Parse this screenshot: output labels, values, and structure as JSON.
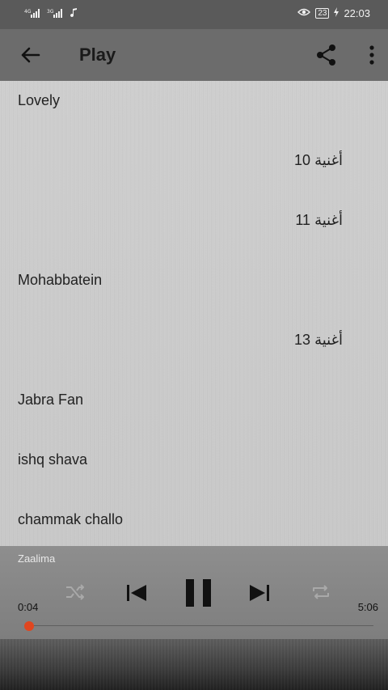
{
  "status_bar": {
    "signal1": "4G",
    "signal2": "3G",
    "battery": "23",
    "time": "22:03",
    "icons": [
      "signal-icon",
      "music-note-icon",
      "eye-icon",
      "battery-icon",
      "charging-icon"
    ]
  },
  "app_bar": {
    "title": "Play",
    "icons": [
      "back-arrow-icon",
      "share-icon",
      "more-vert-icon"
    ]
  },
  "playlist": {
    "items": [
      {
        "label": "Lovely"
      },
      {
        "label": "أغنية 10"
      },
      {
        "label": "أغنية 11"
      },
      {
        "label": "Mohabbatein"
      },
      {
        "label": "أغنية 13"
      },
      {
        "label": "Jabra Fan"
      },
      {
        "label": "ishq shava"
      },
      {
        "label": "chammak challo"
      }
    ]
  },
  "player": {
    "now_playing": "Zaalima",
    "current_time": "0:04",
    "total_time": "5:06",
    "progress_fraction": 0.013,
    "icons": [
      "shuffle-icon",
      "skip-previous-icon",
      "pause-icon",
      "skip-next-icon",
      "repeat-icon"
    ],
    "colors": {
      "seek_thumb": "#e0461f"
    }
  }
}
